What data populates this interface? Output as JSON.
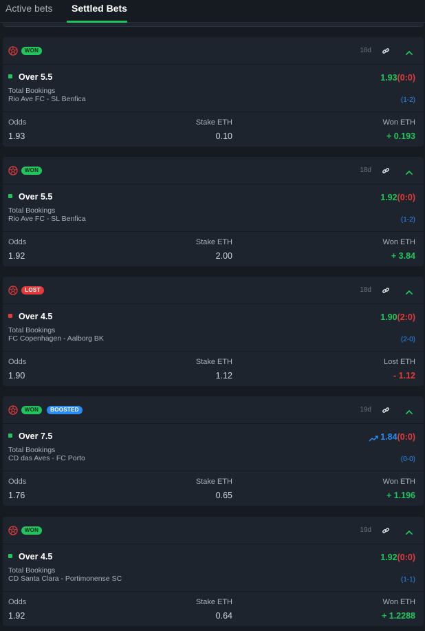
{
  "tabs": [
    {
      "label": "Active bets",
      "active": false
    },
    {
      "label": "Settled Bets",
      "active": true
    }
  ],
  "labels": {
    "odds": "Odds",
    "stake": "Stake ETH"
  },
  "colors": {
    "won": "#21c55e",
    "lost": "#e23b3b",
    "boosted": "#2a8bf2",
    "background": "#161b22",
    "card": "#1e242d"
  },
  "bets": [
    {
      "status": "WON",
      "boost": null,
      "age": "18d",
      "selection": "Over 5.5",
      "market": "Total Bookings",
      "match": "Rio Ave FC - SL Benfica",
      "price": "1.93",
      "score_at_bet": "(0:0)",
      "final_score": "(1-2)",
      "odds": "1.93",
      "stake": "0.10",
      "result_label": "Won ETH",
      "result_value": "+ 0.193"
    },
    {
      "status": "WON",
      "boost": null,
      "age": "18d",
      "selection": "Over 5.5",
      "market": "Total Bookings",
      "match": "Rio Ave FC - SL Benfica",
      "price": "1.92",
      "score_at_bet": "(0:0)",
      "final_score": "(1-2)",
      "odds": "1.92",
      "stake": "2.00",
      "result_label": "Won ETH",
      "result_value": "+ 3.84"
    },
    {
      "status": "LOST",
      "boost": null,
      "age": "18d",
      "selection": "Over 4.5",
      "market": "Total Bookings",
      "match": "FC Copenhagen - Aalborg BK",
      "price": "1.90",
      "score_at_bet": "(2:0)",
      "final_score": "(2-0)",
      "odds": "1.90",
      "stake": "1.12",
      "result_label": "Lost ETH",
      "result_value": "- 1.12"
    },
    {
      "status": "WON",
      "boost": "BOOSTED",
      "age": "19d",
      "selection": "Over 7.5",
      "market": "Total Bookings",
      "match": "CD das Aves - FC Porto",
      "price": "1.84",
      "score_at_bet": "(0:0)",
      "final_score": "(0-0)",
      "odds": "1.76",
      "stake": "0.65",
      "result_label": "Won ETH",
      "result_value": "+ 1.196"
    },
    {
      "status": "WON",
      "boost": null,
      "age": "19d",
      "selection": "Over 4.5",
      "market": "Total Bookings",
      "match": "CD Santa Clara - Portimonense SC",
      "price": "1.92",
      "score_at_bet": "(0:0)",
      "final_score": "(1-1)",
      "odds": "1.92",
      "stake": "0.64",
      "result_label": "Won ETH",
      "result_value": "+ 1.2288"
    }
  ]
}
